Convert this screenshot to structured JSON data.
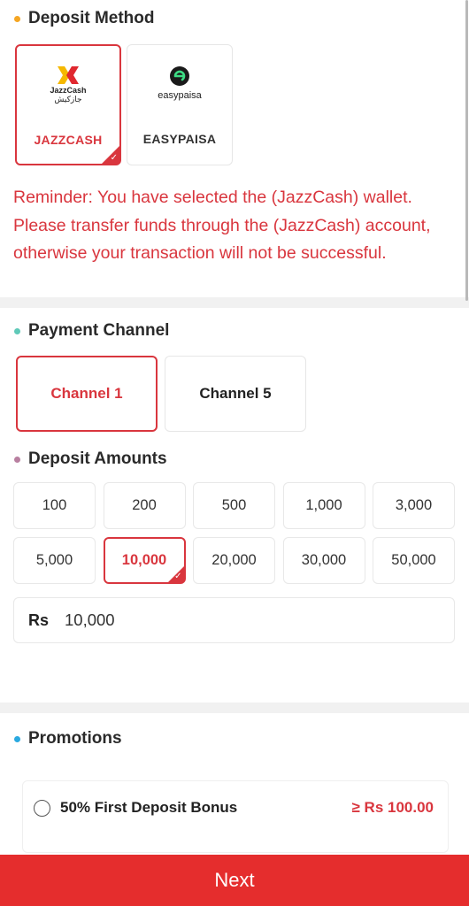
{
  "deposit_method": {
    "title": "Deposit Method",
    "dot_color": "#f5a623",
    "methods": [
      {
        "name": "JAZZCASH",
        "logo_text": "JazzCash",
        "logo_subtext": "جازکیش",
        "selected": true
      },
      {
        "name": "EASYPAISA",
        "logo_text": "easypaisa",
        "selected": false
      }
    ],
    "reminder": "Reminder: You have selected the (JazzCash) wallet. Please transfer funds through the (JazzCash) account, otherwise your transaction will not be successful."
  },
  "payment_channel": {
    "title": "Payment Channel",
    "dot_color": "#5fc9b8",
    "channels": [
      {
        "label": "Channel 1",
        "selected": true
      },
      {
        "label": "Channel 5",
        "selected": false
      }
    ]
  },
  "deposit_amounts": {
    "title": "Deposit Amounts",
    "dot_color": "#b87fa0",
    "options": [
      "100",
      "200",
      "500",
      "1,000",
      "3,000",
      "5,000",
      "10,000",
      "20,000",
      "30,000",
      "50,000"
    ],
    "selected": "10,000",
    "currency": "Rs",
    "input_value": "10,000"
  },
  "promotions": {
    "title": "Promotions",
    "dot_color": "#2aa9e0",
    "items": [
      {
        "name": "50% First Deposit Bonus",
        "min": "≥ Rs 100.00"
      }
    ]
  },
  "next_label": "Next",
  "accent_color": "#d9363e"
}
